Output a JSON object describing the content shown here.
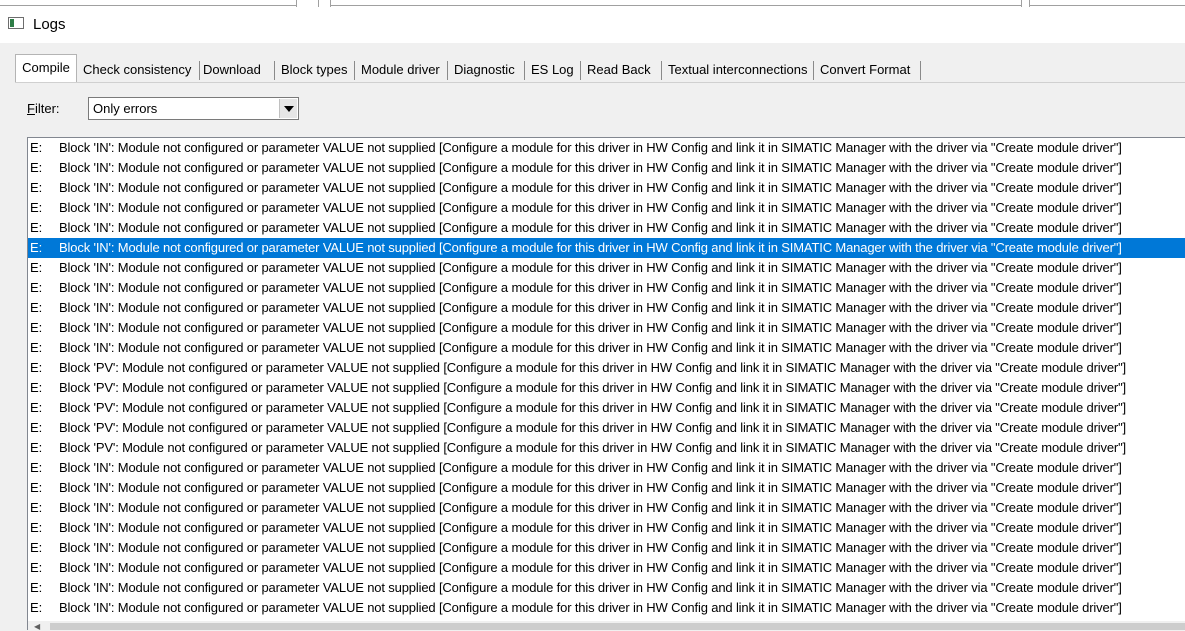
{
  "window": {
    "title": "Logs"
  },
  "tabs": [
    {
      "label": "Compile",
      "active": true
    },
    {
      "label": "Check consistency"
    },
    {
      "label": "Download"
    },
    {
      "label": "Block types"
    },
    {
      "label": "Module driver"
    },
    {
      "label": "Diagnostic"
    },
    {
      "label": "ES Log"
    },
    {
      "label": "Read Back"
    },
    {
      "label": "Textual interconnections"
    },
    {
      "label": "Convert Format"
    }
  ],
  "filter": {
    "label": "Filter:",
    "value": "Only errors"
  },
  "log": {
    "selected_index": 5,
    "rows": [
      {
        "level": "E:",
        "message": "Block 'IN': Module not configured or parameter VALUE not supplied [Configure a module for this driver in HW Config and link it in SIMATIC Manager with the driver via \"Create module driver\"]"
      },
      {
        "level": "E:",
        "message": "Block 'IN': Module not configured or parameter VALUE not supplied [Configure a module for this driver in HW Config and link it in SIMATIC Manager with the driver via \"Create module driver\"]"
      },
      {
        "level": "E:",
        "message": "Block 'IN': Module not configured or parameter VALUE not supplied [Configure a module for this driver in HW Config and link it in SIMATIC Manager with the driver via \"Create module driver\"]"
      },
      {
        "level": "E:",
        "message": "Block 'IN': Module not configured or parameter VALUE not supplied [Configure a module for this driver in HW Config and link it in SIMATIC Manager with the driver via \"Create module driver\"]"
      },
      {
        "level": "E:",
        "message": "Block 'IN': Module not configured or parameter VALUE not supplied [Configure a module for this driver in HW Config and link it in SIMATIC Manager with the driver via \"Create module driver\"]"
      },
      {
        "level": "E:",
        "message": "Block 'IN': Module not configured or parameter VALUE not supplied [Configure a module for this driver in HW Config and link it in SIMATIC Manager with the driver via \"Create module driver\"]"
      },
      {
        "level": "E:",
        "message": "Block 'IN': Module not configured or parameter VALUE not supplied [Configure a module for this driver in HW Config and link it in SIMATIC Manager with the driver via \"Create module driver\"]"
      },
      {
        "level": "E:",
        "message": "Block 'IN': Module not configured or parameter VALUE not supplied [Configure a module for this driver in HW Config and link it in SIMATIC Manager with the driver via \"Create module driver\"]"
      },
      {
        "level": "E:",
        "message": "Block 'IN': Module not configured or parameter VALUE not supplied [Configure a module for this driver in HW Config and link it in SIMATIC Manager with the driver via \"Create module driver\"]"
      },
      {
        "level": "E:",
        "message": "Block 'IN': Module not configured or parameter VALUE not supplied [Configure a module for this driver in HW Config and link it in SIMATIC Manager with the driver via \"Create module driver\"]"
      },
      {
        "level": "E:",
        "message": "Block 'IN': Module not configured or parameter VALUE not supplied [Configure a module for this driver in HW Config and link it in SIMATIC Manager with the driver via \"Create module driver\"]"
      },
      {
        "level": "E:",
        "message": "Block 'PV': Module not configured or parameter VALUE not supplied [Configure a module for this driver in HW Config and link it in SIMATIC Manager with the driver via \"Create module driver\"]"
      },
      {
        "level": "E:",
        "message": "Block 'PV': Module not configured or parameter VALUE not supplied [Configure a module for this driver in HW Config and link it in SIMATIC Manager with the driver via \"Create module driver\"]"
      },
      {
        "level": "E:",
        "message": "Block 'PV': Module not configured or parameter VALUE not supplied [Configure a module for this driver in HW Config and link it in SIMATIC Manager with the driver via \"Create module driver\"]"
      },
      {
        "level": "E:",
        "message": "Block 'PV': Module not configured or parameter VALUE not supplied [Configure a module for this driver in HW Config and link it in SIMATIC Manager with the driver via \"Create module driver\"]"
      },
      {
        "level": "E:",
        "message": "Block 'PV': Module not configured or parameter VALUE not supplied [Configure a module for this driver in HW Config and link it in SIMATIC Manager with the driver via \"Create module driver\"]"
      },
      {
        "level": "E:",
        "message": "Block 'IN': Module not configured or parameter VALUE not supplied [Configure a module for this driver in HW Config and link it in SIMATIC Manager with the driver via \"Create module driver\"]"
      },
      {
        "level": "E:",
        "message": "Block 'IN': Module not configured or parameter VALUE not supplied [Configure a module for this driver in HW Config and link it in SIMATIC Manager with the driver via \"Create module driver\"]"
      },
      {
        "level": "E:",
        "message": "Block 'IN': Module not configured or parameter VALUE not supplied [Configure a module for this driver in HW Config and link it in SIMATIC Manager with the driver via \"Create module driver\"]"
      },
      {
        "level": "E:",
        "message": "Block 'IN': Module not configured or parameter VALUE not supplied [Configure a module for this driver in HW Config and link it in SIMATIC Manager with the driver via \"Create module driver\"]"
      },
      {
        "level": "E:",
        "message": "Block 'IN': Module not configured or parameter VALUE not supplied [Configure a module for this driver in HW Config and link it in SIMATIC Manager with the driver via \"Create module driver\"]"
      },
      {
        "level": "E:",
        "message": "Block 'IN': Module not configured or parameter VALUE not supplied [Configure a module for this driver in HW Config and link it in SIMATIC Manager with the driver via \"Create module driver\"]"
      },
      {
        "level": "E:",
        "message": "Block 'IN': Module not configured or parameter VALUE not supplied [Configure a module for this driver in HW Config and link it in SIMATIC Manager with the driver via \"Create module driver\"]"
      },
      {
        "level": "E:",
        "message": "Block 'IN': Module not configured or parameter VALUE not supplied [Configure a module for this driver in HW Config and link it in SIMATIC Manager with the driver via \"Create module driver\"]"
      }
    ]
  },
  "colors": {
    "selection": "#0078d7",
    "window_bg": "#f0f0f0",
    "list_bg": "#ffffff"
  }
}
